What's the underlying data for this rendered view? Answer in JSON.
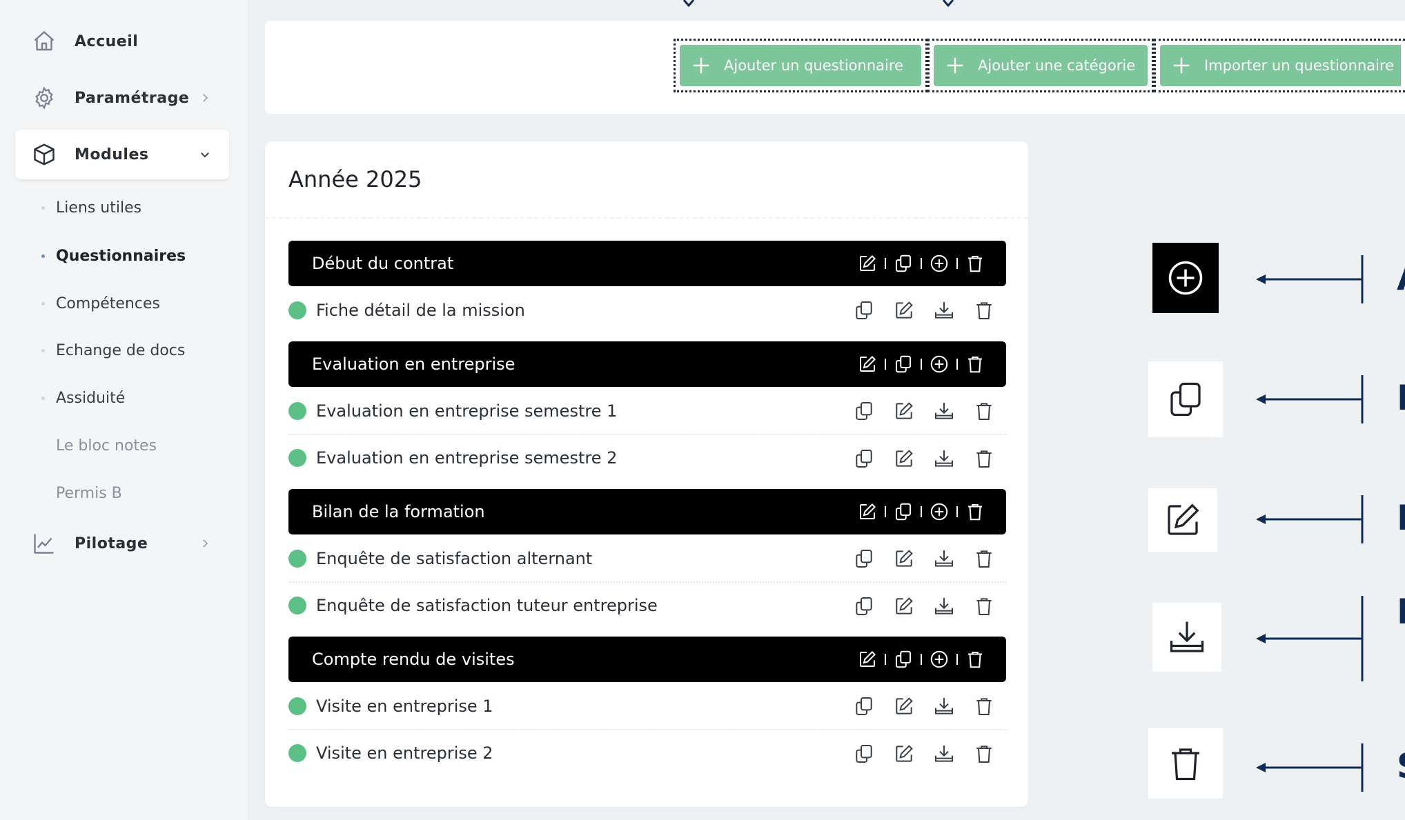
{
  "sidebar": {
    "items": [
      {
        "label": "Accueil",
        "icon": "home-icon"
      },
      {
        "label": "Paramétrage",
        "icon": "gear-icon"
      },
      {
        "label": "Modules",
        "icon": "cube-icon"
      },
      {
        "label": "Pilotage",
        "icon": "chart-line-icon"
      }
    ],
    "sub_items": [
      {
        "label": "Liens utiles"
      },
      {
        "label": "Questionnaires"
      },
      {
        "label": "Compétences"
      },
      {
        "label": "Echange de docs"
      },
      {
        "label": "Assiduité"
      },
      {
        "label": "Le bloc notes"
      },
      {
        "label": "Permis B"
      }
    ]
  },
  "toolbar": {
    "add_questionnaire": "Ajouter un questionnaire",
    "add_category": "Ajouter une catégorie",
    "import_questionnaire": "Importer un questionnaire"
  },
  "card": {
    "title": "Année 2025",
    "categories": [
      {
        "label": "Début du contrat",
        "questionnaires": [
          "Fiche détail de la mission"
        ]
      },
      {
        "label": "Evaluation en entreprise",
        "questionnaires": [
          "Evaluation en entreprise semestre 1",
          "Evaluation en entreprise semestre 2"
        ]
      },
      {
        "label": "Bilan de la formation",
        "questionnaires": [
          "Enquête de satisfaction alternant",
          "Enquête de satisfaction tuteur entreprise"
        ]
      },
      {
        "label": "Compte rendu de visites",
        "questionnaires": [
          "Visite en entreprise 1",
          "Visite en entreprise 2"
        ]
      }
    ]
  },
  "legend": [
    {
      "icon": "plus-circle-icon",
      "text": "A"
    },
    {
      "icon": "copy-icon",
      "text": "D"
    },
    {
      "icon": "edit-icon",
      "text": "M"
    },
    {
      "icon": "download-icon",
      "text": "E"
    },
    {
      "icon": "trash-icon",
      "text": "S"
    }
  ],
  "colors": {
    "button_green": "#7dc59a",
    "status_green": "#5cbf86",
    "legend_navy": "#0e2a55",
    "category_black": "#000000"
  }
}
